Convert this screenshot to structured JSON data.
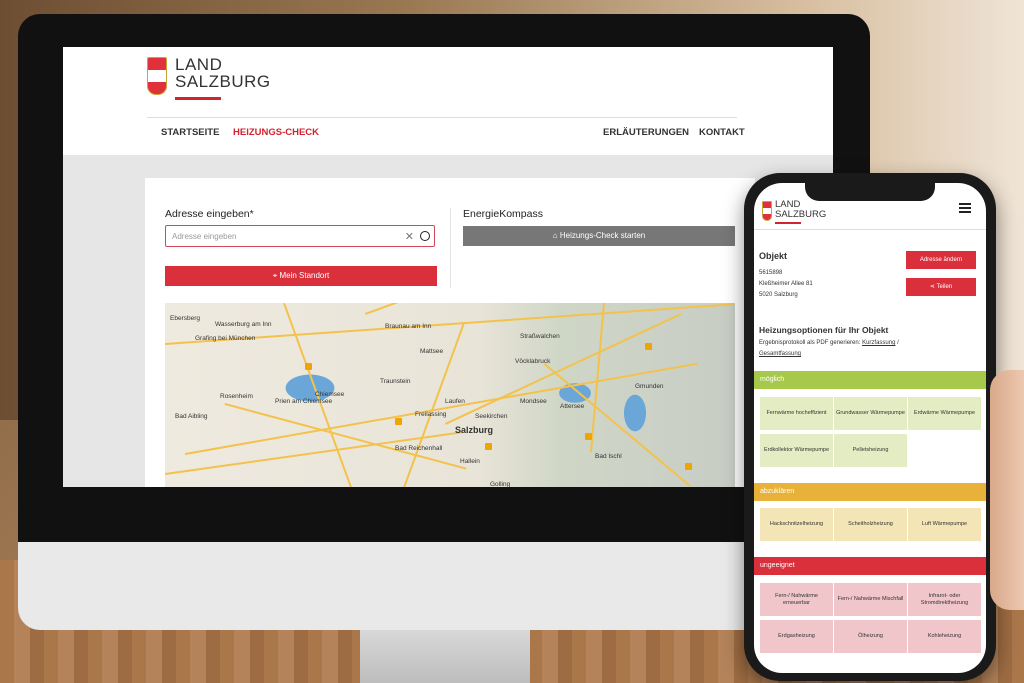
{
  "desktop": {
    "logo": {
      "line1": "LAND",
      "line2": "SALZBURG"
    },
    "nav": {
      "home": "STARTSEITE",
      "check": "HEIZUNGS-CHECK",
      "explain": "ERLÄUTERUNGEN",
      "contact": "KONTAKT"
    },
    "address_label": "Adresse eingeben*",
    "address_placeholder": "Adresse eingeben",
    "location_button": "Mein Standort",
    "kompass_label": "EnergieKompass",
    "start_button": "Heizungs-Check starten",
    "map_places": [
      "Ebersberg",
      "Wasserburg am Inn",
      "Grafing bei München",
      "Rosenheim",
      "Bad Aibling",
      "Prien am Chiemsee",
      "Chiemsee",
      "Traunstein",
      "Salzburg",
      "Bad Reichenhall",
      "Hallein",
      "Vöcklabruck",
      "Mondsee",
      "Attersee",
      "Gmunden",
      "Straßwalchen",
      "Mattsee",
      "Braunau am Inn",
      "Bad Ischl",
      "Golling",
      "Freilassing",
      "Laufen",
      "Seekirchen"
    ]
  },
  "phone": {
    "logo": {
      "line1": "LAND",
      "line2": "SALZBURG"
    },
    "object_title": "Objekt",
    "address_lines": [
      "5615898",
      "Kleßheimer Allee 81",
      "5020 Salzburg"
    ],
    "change_button": "Adresse ändern",
    "share_button": "Teilen",
    "options_title": "Heizungsoptionen für Ihr Objekt",
    "pdf_text": "Ergebnisprotokoll als PDF generieren:",
    "pdf_link_short": "Kurzfassung",
    "pdf_sep": "/",
    "pdf_link_full": "Gesamtfassung",
    "sections": [
      {
        "label": "möglich",
        "tiles": [
          "Fernwärme hocheffizient",
          "Grundwasser Wärmepumpe",
          "Erdwärme Wärmepumpe",
          "Erdkollektor Wärmepumpe",
          "Pelletsheizung"
        ]
      },
      {
        "label": "abzuklären",
        "tiles": [
          "Hackschnitzelheizung",
          "Scheitholzheizung",
          "Luft Wärmepumpe"
        ]
      },
      {
        "label": "ungeeignet",
        "tiles": [
          "Fern-/ Nahwärme erneuerbar",
          "Fern-/ Nahwärme Mischfall",
          "Infrarot- oder Stromdirektheizung",
          "Erdgasheizung",
          "Ölheizung",
          "Kohleheizung"
        ]
      }
    ],
    "colors": {
      "possible": "#a6c84b",
      "clarify": "#e8b23a",
      "unsuitable": "#d9303c"
    }
  }
}
